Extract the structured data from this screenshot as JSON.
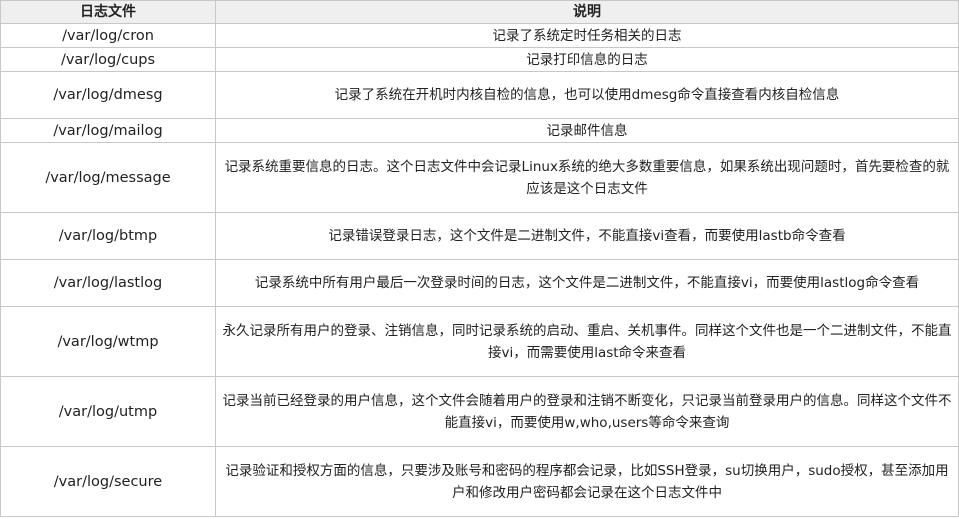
{
  "header": {
    "col_file": "日志文件",
    "col_desc": "说明"
  },
  "rows": [
    {
      "file": "/var/log/cron",
      "desc": "记录了系统定时任务相关的日志"
    },
    {
      "file": "/var/log/cups",
      "desc": "记录打印信息的日志"
    },
    {
      "file": "/var/log/dmesg",
      "desc": "记录了系统在开机时内核自检的信息，也可以使用dmesg命令直接查看内核自检信息"
    },
    {
      "file": "/var/log/mailog",
      "desc": "记录邮件信息"
    },
    {
      "file": "/var/log/message",
      "desc": "记录系统重要信息的日志。这个日志文件中会记录Linux系统的绝大多数重要信息，如果系统出现问题时，首先要检查的就应该是这个日志文件"
    },
    {
      "file": "/var/log/btmp",
      "desc": "记录错误登录日志，这个文件是二进制文件，不能直接vi查看，而要使用lastb命令查看"
    },
    {
      "file": "/var/log/lastlog",
      "desc": "记录系统中所有用户最后一次登录时间的日志，这个文件是二进制文件，不能直接vi，而要使用lastlog命令查看"
    },
    {
      "file": "/var/log/wtmp",
      "desc": "永久记录所有用户的登录、注销信息，同时记录系统的启动、重启、关机事件。同样这个文件也是一个二进制文件，不能直接vi，而需要使用last命令来查看"
    },
    {
      "file": "/var/log/utmp",
      "desc": "记录当前已经登录的用户信息，这个文件会随着用户的登录和注销不断变化，只记录当前登录用户的信息。同样这个文件不能直接vi，而要使用w,who,users等命令来查询"
    },
    {
      "file": "/var/log/secure",
      "desc": "记录验证和授权方面的信息，只要涉及账号和密码的程序都会记录，比如SSH登录，su切换用户，sudo授权，甚至添加用户和修改用户密码都会记录在这个日志文件中"
    }
  ]
}
